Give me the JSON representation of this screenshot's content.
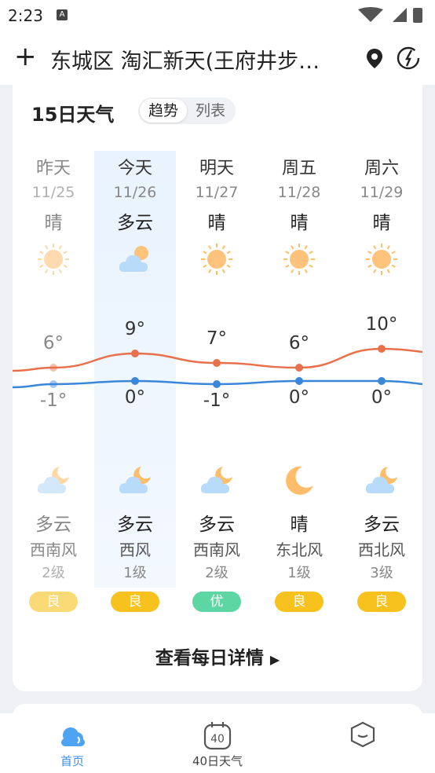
{
  "status": {
    "time": "2:23",
    "notif_icon": "A"
  },
  "header": {
    "title": "东城区 淘汇新天(王府井步…"
  },
  "card": {
    "title": "15日天气",
    "toggle": [
      "趋势",
      "列表"
    ],
    "detail_link": "查看每日详情"
  },
  "days": [
    {
      "day": "昨天",
      "date": "11/25",
      "day_wx": "晴",
      "day_icon": "sun-icon",
      "high": "6°",
      "low": "-1°",
      "night_icon": "partly-cloudy-night-icon",
      "night_wx": "多云",
      "wind": "西南风",
      "level": "2级",
      "aqi": "良",
      "aqi_color": "#f7c21e",
      "past": true
    },
    {
      "day": "今天",
      "date": "11/26",
      "day_wx": "多云",
      "day_icon": "partly-cloudy-icon",
      "high": "9°",
      "low": "0°",
      "night_icon": "partly-cloudy-night-icon",
      "night_wx": "多云",
      "wind": "西风",
      "level": "1级",
      "aqi": "良",
      "aqi_color": "#f7c21e",
      "today": true
    },
    {
      "day": "明天",
      "date": "11/27",
      "day_wx": "晴",
      "day_icon": "sun-icon",
      "high": "7°",
      "low": "-1°",
      "night_icon": "partly-cloudy-night-icon",
      "night_wx": "多云",
      "wind": "西南风",
      "level": "2级",
      "aqi": "优",
      "aqi_color": "#5ed6a4"
    },
    {
      "day": "周五",
      "date": "11/28",
      "day_wx": "晴",
      "day_icon": "sun-icon",
      "high": "6°",
      "low": "0°",
      "night_icon": "moon-icon",
      "night_wx": "晴",
      "wind": "东北风",
      "level": "1级",
      "aqi": "良",
      "aqi_color": "#f7c21e"
    },
    {
      "day": "周六",
      "date": "11/29",
      "day_wx": "晴",
      "day_icon": "sun-icon",
      "high": "10°",
      "low": "0°",
      "night_icon": "partly-cloudy-night-icon",
      "night_wx": "多云",
      "wind": "西北风",
      "level": "3级",
      "aqi": "良",
      "aqi_color": "#f7c21e"
    }
  ],
  "temp_series": {
    "high": [
      6,
      9,
      7,
      6,
      10
    ],
    "low": [
      -1,
      0,
      -1,
      0,
      0
    ],
    "high_color": "#e8704a",
    "low_color": "#3a86d8"
  },
  "tabs": [
    {
      "label": "首页",
      "icon": "home-cloud-icon",
      "active": true
    },
    {
      "label": "40日天气",
      "icon": "calendar-40-icon",
      "badge": "40"
    },
    {
      "label": "",
      "icon": "cube-icon"
    }
  ]
}
